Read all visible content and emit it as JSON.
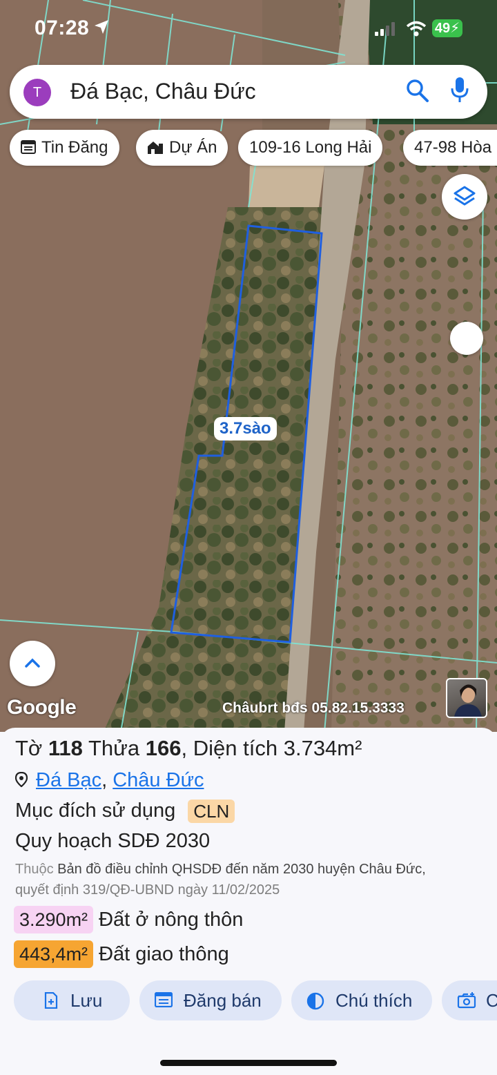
{
  "status_bar": {
    "time": "07:28",
    "battery": "49"
  },
  "search": {
    "avatar_letter": "T",
    "query": "Đá Bạc, Châu Đức"
  },
  "chips": [
    {
      "label": "Tin Đăng",
      "icon": "listing-icon"
    },
    {
      "label": "Dự Án",
      "icon": "building-icon"
    },
    {
      "label": "109-16 Long Hải"
    },
    {
      "label": "47-98 Hòa"
    }
  ],
  "map": {
    "area_label": "3.7sào",
    "google_logo": "Google",
    "watermark": "Châubrt bđs 05.82.15.3333",
    "plot_outline_color": "#1f5fe0"
  },
  "parcel": {
    "to_label": "Tờ",
    "to_value": "118",
    "thua_label": "Thửa",
    "thua_value": "166",
    "area_label": "Diện tích",
    "area_value": "3.734m²",
    "commune": "Đá Bạc",
    "district": "Châu Đức",
    "purpose_label": "Mục đích sử dụng",
    "purpose_code": "CLN",
    "plan_title": "Quy hoạch SDĐ 2030",
    "note_prefix": "Thuộc",
    "note_line1": "Bản đồ điều chỉnh QHSDĐ đến năm 2030 huyện Châu Đức,",
    "note_line2": "quyết định 319/QĐ-UBND ngày 11/02/2025",
    "land_uses": [
      {
        "value": "3.290m²",
        "label": "Đất ở nông thôn",
        "color": "#f7d3f3"
      },
      {
        "value": "443,4m²",
        "label": "Đất giao thông",
        "color": "#f6a532"
      }
    ]
  },
  "actions": [
    {
      "label": "Lưu",
      "icon": "add-file-icon"
    },
    {
      "label": "Đăng bán",
      "icon": "listing-icon"
    },
    {
      "label": "Chú thích",
      "icon": "contrast-icon"
    },
    {
      "label": "C",
      "icon": "camera-add-icon"
    }
  ]
}
